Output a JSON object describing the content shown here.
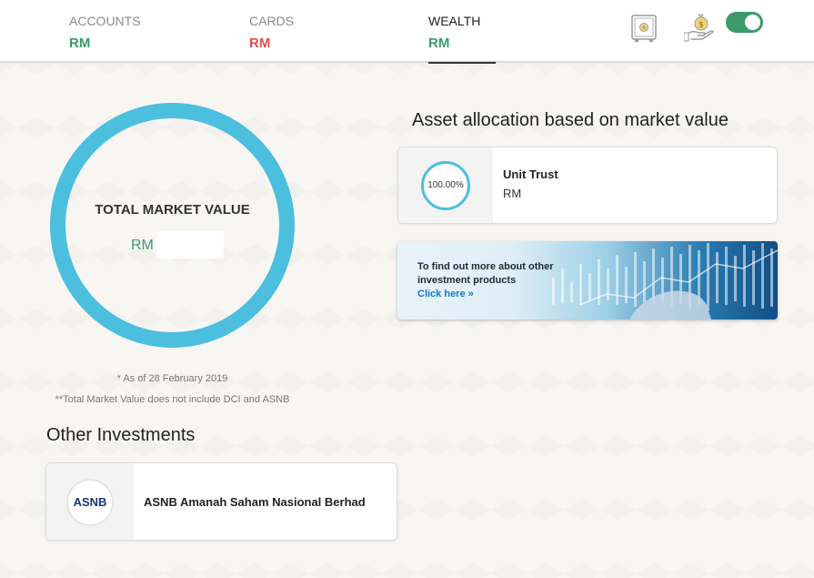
{
  "header": {
    "tabs": [
      {
        "label": "ACCOUNTS",
        "value": "RM",
        "color": "#3d9a6b"
      },
      {
        "label": "CARDS",
        "value": "RM",
        "color": "#d9534f"
      },
      {
        "label": "WEALTH",
        "value": "RM",
        "color": "#3d9a6b"
      }
    ],
    "active_tab": "WEALTH",
    "icons": [
      "safe-icon",
      "money-hand-icon"
    ],
    "toggle_on": true
  },
  "summary": {
    "title": "TOTAL MARKET VALUE",
    "value": "RM",
    "ring_color": "#4bbfdd",
    "note_date": "* As of 28 February 2019",
    "note_exclusion": "**Total Market Value does not include DCI and ASNB"
  },
  "allocation": {
    "title": "Asset allocation based on market value",
    "items": [
      {
        "percent": "100.00%",
        "name": "Unit Trust",
        "value": "RM"
      }
    ]
  },
  "banner": {
    "text": "To find out more about other investment products",
    "link": "Click here »"
  },
  "other": {
    "title": "Other Investments",
    "items": [
      {
        "logo": "ASNB",
        "name": "ASNB Amanah Saham Nasional Berhad"
      }
    ]
  }
}
